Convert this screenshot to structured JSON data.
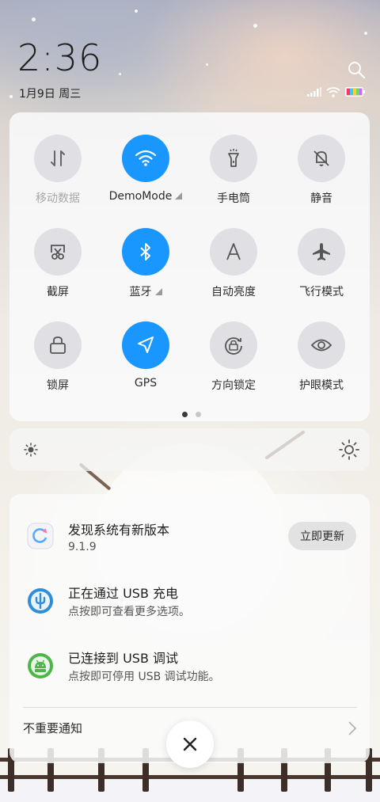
{
  "header": {
    "time": "2:36",
    "date": "1月9日 周三"
  },
  "quick_settings": {
    "tiles": [
      {
        "label": "移动数据",
        "icon": "mobile-data-icon",
        "state": "off"
      },
      {
        "label": "DemoMode",
        "icon": "wifi-icon",
        "state": "on"
      },
      {
        "label": "手电筒",
        "icon": "flashlight-icon",
        "state": "off"
      },
      {
        "label": "静音",
        "icon": "mute-icon",
        "state": "off"
      },
      {
        "label": "截屏",
        "icon": "screenshot-icon",
        "state": "off"
      },
      {
        "label": "蓝牙",
        "icon": "bluetooth-icon",
        "state": "on"
      },
      {
        "label": "自动亮度",
        "icon": "auto-brightness-icon",
        "state": "off"
      },
      {
        "label": "飞行模式",
        "icon": "airplane-icon",
        "state": "off"
      },
      {
        "label": "锁屏",
        "icon": "lock-icon",
        "state": "off"
      },
      {
        "label": "GPS",
        "icon": "gps-icon",
        "state": "on"
      },
      {
        "label": "方向锁定",
        "icon": "rotation-lock-icon",
        "state": "off"
      },
      {
        "label": "护眼模式",
        "icon": "eye-icon",
        "state": "off"
      }
    ],
    "page_count": 2,
    "active_page": 1
  },
  "notifications": {
    "items": [
      {
        "title": "发现系统有新版本",
        "subtitle": "9.1.9",
        "action": "立即更新",
        "icon": "system-update-icon"
      },
      {
        "title": "正在通过 USB 充电",
        "subtitle": "点按即可查看更多选项。",
        "icon": "usb-icon"
      },
      {
        "title": "已连接到 USB 调试",
        "subtitle": "点按即可停用 USB 调试功能。",
        "icon": "android-debug-icon"
      }
    ],
    "unimportant_label": "不重要通知"
  },
  "colors": {
    "accent": "#1a97ff",
    "panel": "#fafafc"
  }
}
